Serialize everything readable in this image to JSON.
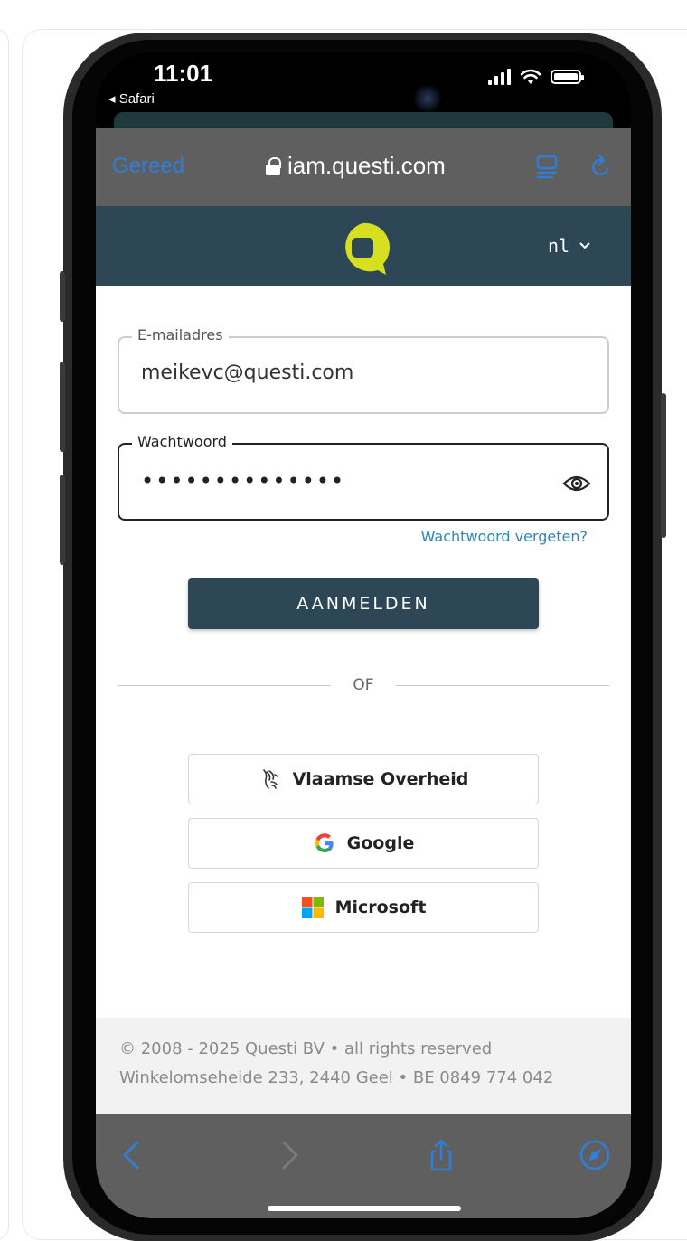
{
  "status_bar": {
    "time": "11:01",
    "back_app": "◂ Safari"
  },
  "safari": {
    "done_label": "Gereed",
    "url": "iam.questi.com"
  },
  "header": {
    "language": "nl"
  },
  "login": {
    "email_label": "E-mailadres",
    "email_value": "meikevc@questi.com",
    "password_label": "Wachtwoord",
    "password_mask": "••••••••••••••",
    "forgot_label": "Wachtwoord vergeten?",
    "submit_label": "AANMELDEN",
    "divider_label": "OF"
  },
  "sso": {
    "vlaamse_overheid": "Vlaamse Overheid",
    "google": "Google",
    "microsoft": "Microsoft"
  },
  "footer": {
    "line1": "© 2008 - 2025 Questi BV • all rights reserved",
    "line2": "Winkelomseheide 233, 2440 Geel • BE 0849 774 042"
  },
  "colors": {
    "header_bg": "#2e4756",
    "logo_yellow": "#d6e021",
    "link_blue": "#2c89b8",
    "safari_blue": "#2f7fd6"
  }
}
